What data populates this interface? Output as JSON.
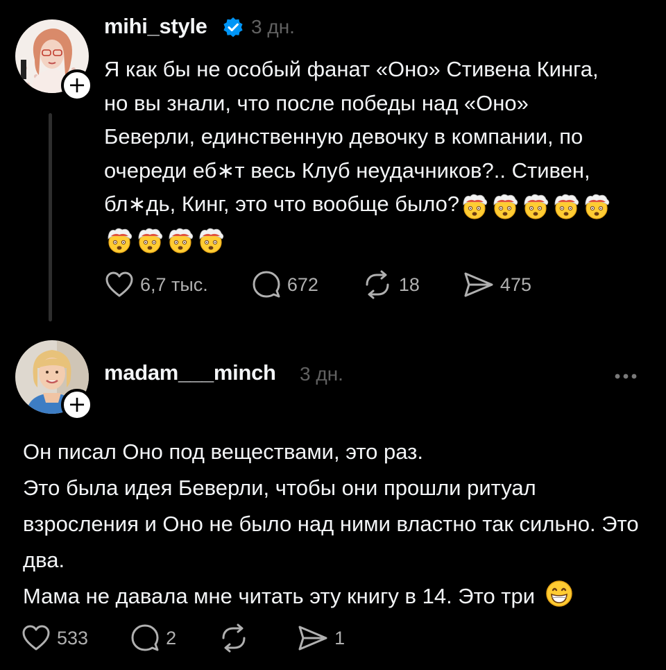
{
  "post": {
    "username": "mihi_style",
    "verified": true,
    "time": "3 дн.",
    "text_lines": [
      "Я как бы не особый фанат «Оно» Стивена Кинга,",
      "но вы знали, что после победы над «Оно»",
      "Беверли, единственную девочку в компании, по",
      "очереди еб∗т весь Клуб неудачников?.. Стивен,",
      "бл∗дь, Кинг, это что вообще было?"
    ],
    "emoji": "exploding-head",
    "emoji_count": 9,
    "likes": "6,7 тыс.",
    "comments": "672",
    "reposts": "18",
    "shares": "475"
  },
  "reply": {
    "username": "madam___minch",
    "time": "3 дн.",
    "paragraphs": [
      "Он писал Оно под веществами, это раз.",
      "Это была идея Беверли, чтобы они прошли ритуал взросления и Оно не было над ними властно так сильно. Это два.",
      "Мама не давала мне читать эту книгу в 14. Это три"
    ],
    "trailing_emoji": "grinning-face",
    "likes": "533",
    "comments": "2",
    "reposts": "",
    "shares": "1"
  },
  "colors": {
    "background": "#000000",
    "text": "#f3f5f7",
    "secondary": "#616161",
    "verified": "#0095f6"
  }
}
